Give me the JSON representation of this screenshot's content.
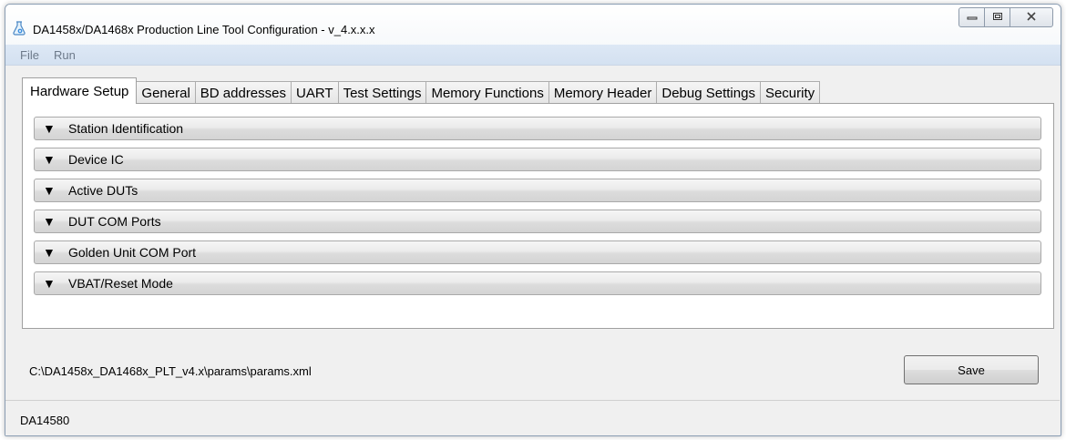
{
  "window": {
    "title": "DA1458x/DA1468x Production Line Tool Configuration - v_4.x.x.x",
    "icon": "app-flask-icon",
    "controls": {
      "minimize": "minimize-icon",
      "maximize": "maximize-icon",
      "close": "close-icon"
    }
  },
  "menu": {
    "items": [
      {
        "label": "File"
      },
      {
        "label": "Run"
      }
    ]
  },
  "tabs": [
    {
      "label": "Hardware Setup",
      "active": true
    },
    {
      "label": "General"
    },
    {
      "label": "BD addresses"
    },
    {
      "label": "UART"
    },
    {
      "label": "Test Settings"
    },
    {
      "label": "Memory Functions"
    },
    {
      "label": "Memory Header"
    },
    {
      "label": "Debug Settings"
    },
    {
      "label": "Security"
    }
  ],
  "sections": [
    {
      "label": "Station Identification",
      "arrow": "▼"
    },
    {
      "label": "Device IC",
      "arrow": "▼"
    },
    {
      "label": "Active DUTs",
      "arrow": "▼"
    },
    {
      "label": "DUT COM Ports",
      "arrow": "▼"
    },
    {
      "label": "Golden Unit COM Port",
      "arrow": "▼"
    },
    {
      "label": "VBAT/Reset Mode",
      "arrow": "▼"
    }
  ],
  "footer": {
    "file_path": "C:\\DA1458x_DA1468x_PLT_v4.x\\params\\params.xml",
    "save_label": "Save"
  },
  "status": {
    "text": "DA14580"
  }
}
